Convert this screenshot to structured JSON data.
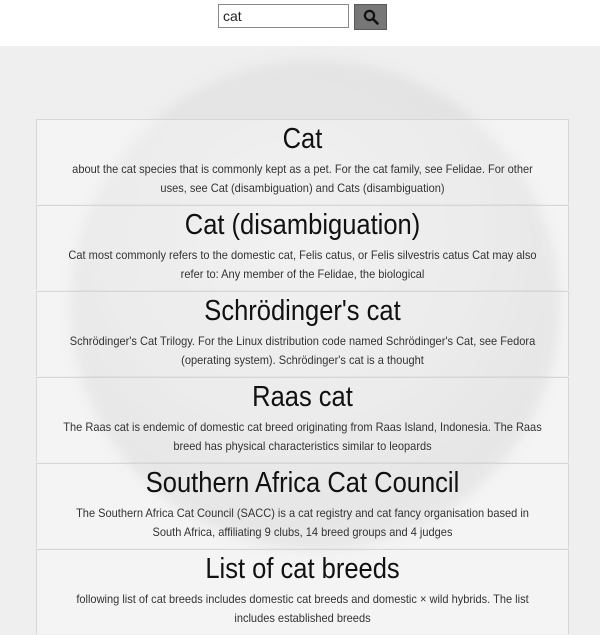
{
  "search": {
    "value": "cat",
    "button_icon": "search-icon"
  },
  "results": [
    {
      "title": "Cat",
      "snippet": "about the cat species that is commonly kept as a pet. For the cat family, see Felidae. For other uses, see Cat (disambiguation) and Cats (disambiguation)"
    },
    {
      "title": "Cat (disambiguation)",
      "snippet": "Cat most commonly refers to the domestic cat, Felis catus, or Felis silvestris catus Cat may also refer to: Any member of the Felidae, the biological"
    },
    {
      "title": "Schrödinger's cat",
      "snippet": "Schrödinger's Cat Trilogy. For the Linux distribution code named Schrödinger's Cat, see Fedora (operating system). Schrödinger's cat is a thought"
    },
    {
      "title": "Raas cat",
      "snippet": "The Raas cat is endemic of domestic cat breed originating from Raas Island, Indonesia. The Raas breed has physical characteristics similar to leopards"
    },
    {
      "title": "Southern Africa Cat Council",
      "snippet": "The Southern Africa Cat Council (SACC) is a cat registry and cat fancy organisation based in South Africa, affiliating 9 clubs, 14 breed groups and 4 judges"
    },
    {
      "title": "List of cat breeds",
      "snippet": "following list of cat breeds includes domestic cat breeds and domestic × wild hybrids. The list includes established breeds"
    }
  ]
}
